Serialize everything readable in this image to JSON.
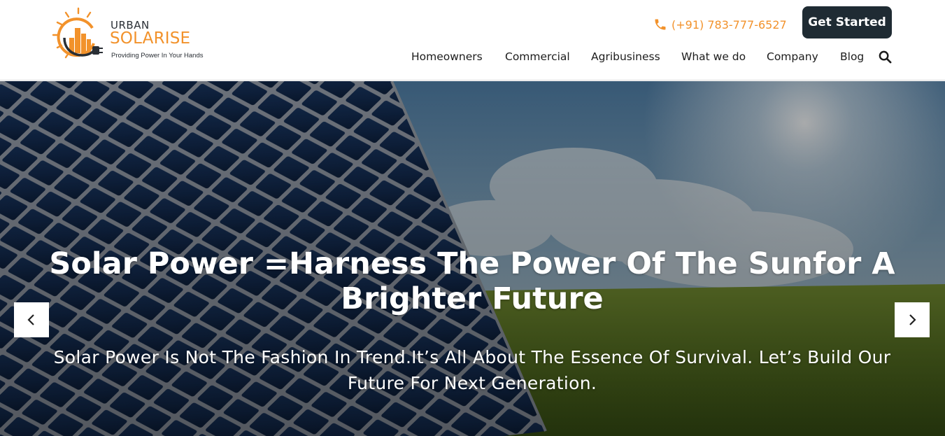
{
  "brand": {
    "name_top": "URBAN",
    "name_main": "SOLARISE",
    "tagline": "Providing Power In Your Hands",
    "logo_icon": "sun-city-plug-icon",
    "accent_color": "#f2922b",
    "dark_color": "#1f2b33"
  },
  "header": {
    "phone": "(+91) 783-777-6527",
    "phone_icon": "phone-icon",
    "cta_label": "Get Started"
  },
  "nav": {
    "items": [
      {
        "label": "Homeowners"
      },
      {
        "label": "Commercial"
      },
      {
        "label": "Agribusiness"
      },
      {
        "label": "What we do"
      },
      {
        "label": "Company"
      },
      {
        "label": "Blog"
      }
    ],
    "search_icon": "search-icon"
  },
  "hero": {
    "title": "Solar Power =Harness The Power Of The Sunfor A Brighter Future",
    "subtitle": "Solar Power Is Not The Fashion In Trend.It’s All About The Essence Of Survival. Let’s Build Our Future For Next Generation.",
    "prev_icon": "chevron-left-icon",
    "next_icon": "chevron-right-icon"
  }
}
